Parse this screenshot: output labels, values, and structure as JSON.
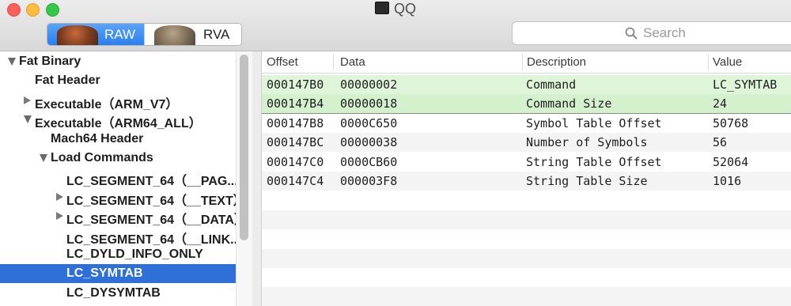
{
  "window": {
    "title": "QQ"
  },
  "toolbar": {
    "raw_label": "RAW",
    "rva_label": "RVA",
    "search_placeholder": "Search"
  },
  "sidebar": {
    "items": [
      {
        "label": "Fat Binary",
        "level": 0,
        "disclosure": "open"
      },
      {
        "label": "Fat Header",
        "level": 1,
        "disclosure": "none"
      },
      {
        "label": "Executable（ARM_V7）",
        "level": 1,
        "disclosure": "closed"
      },
      {
        "label": "Executable（ARM64_ALL）",
        "level": 1,
        "disclosure": "open"
      },
      {
        "label": "Mach64 Header",
        "level": 2,
        "disclosure": "none"
      },
      {
        "label": "Load Commands",
        "level": 2,
        "disclosure": "open"
      },
      {
        "label": "LC_SEGMENT_64（__PAG...",
        "level": 3,
        "disclosure": "none"
      },
      {
        "label": "LC_SEGMENT_64（__TEXT）",
        "level": 3,
        "disclosure": "closed"
      },
      {
        "label": "LC_SEGMENT_64（__DATA）",
        "level": 3,
        "disclosure": "closed"
      },
      {
        "label": "LC_SEGMENT_64（__LINK...",
        "level": 3,
        "disclosure": "none"
      },
      {
        "label": "LC_DYLD_INFO_ONLY",
        "level": 3,
        "disclosure": "none"
      },
      {
        "label": "LC_SYMTAB",
        "level": 3,
        "disclosure": "none",
        "selected": true
      },
      {
        "label": "LC_DYSYMTAB",
        "level": 3,
        "disclosure": "none"
      }
    ]
  },
  "table": {
    "headers": [
      "Offset",
      "Data",
      "Description",
      "Value"
    ],
    "rows": [
      [
        "000147B0",
        "00000002",
        "Command",
        "LC_SYMTAB"
      ],
      [
        "000147B4",
        "00000018",
        "Command Size",
        "24"
      ],
      [
        "000147B8",
        "0000C650",
        "Symbol Table Offset",
        "50768"
      ],
      [
        "000147BC",
        "00000038",
        "Number of Symbols",
        "56"
      ],
      [
        "000147C0",
        "0000CB60",
        "String Table Offset",
        "52064"
      ],
      [
        "000147C4",
        "000003F8",
        "String Table Size",
        "1016"
      ]
    ]
  },
  "colors": {
    "selection": "#2f6fd8",
    "highlight_row": "#dff5d9",
    "accent": "#2a7ff0"
  }
}
